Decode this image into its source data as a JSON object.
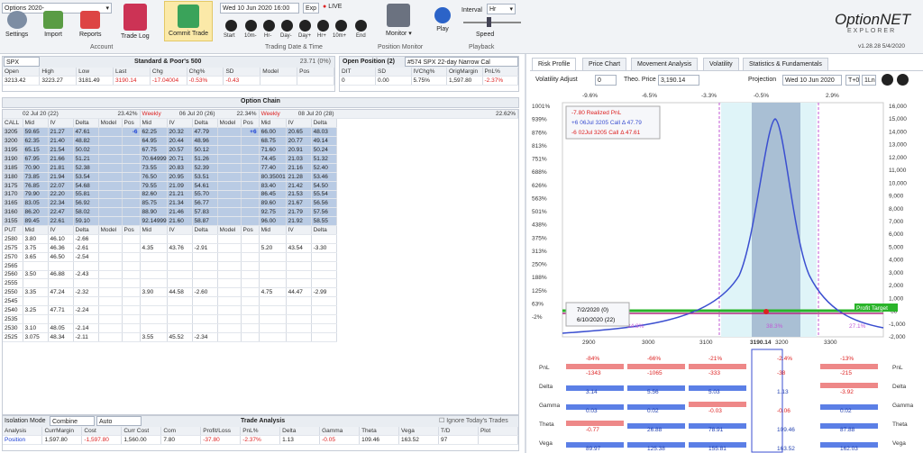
{
  "toolbar": {
    "portfolio": "Options 2020-",
    "buttons": {
      "settings": "Settings",
      "import": "Import",
      "reports": "Reports",
      "trade_log": "Trade Log",
      "commit": "Commit Trade",
      "monitor": "Monitor",
      "play": "Play"
    },
    "groups": {
      "account": "Account",
      "trading": "Trading Date & Time",
      "position_monitor": "Position Monitor",
      "playback": "Playback"
    },
    "datetime": "Wed 10 Jun 2020 16:00",
    "exp_label": "Exp",
    "live_label": "LIVE",
    "nav": [
      "Start",
      "10m-",
      "Hr-",
      "Day-",
      "Day+",
      "Hr+",
      "10m+",
      "End"
    ],
    "interval_label": "Interval",
    "interval_value": "Hr",
    "speed_label": "Speed",
    "brand1": "OptionNET",
    "brand2": "EXPLORER",
    "version": "v1.28.28  5/4/2020"
  },
  "underlying": {
    "symbol": "SPX",
    "name": "Standard & Poor's 500",
    "iv": "23.71 (0%)",
    "cols": [
      "Open",
      "High",
      "Low",
      "Last",
      "Chg",
      "Chg%",
      "SD",
      "Model",
      "Pos"
    ],
    "vals": [
      "3213.42",
      "3223.27",
      "3181.49",
      "3190.14",
      "-17.04004",
      "-0.53%",
      "-0.43",
      "",
      ""
    ]
  },
  "position": {
    "title": "Open Position (2)",
    "name": "#574 SPX 22-day Narrow Cal",
    "cols": [
      "DIT",
      "SD",
      "IVChg%",
      "OrigMargin",
      "PnL%"
    ],
    "vals": [
      "0",
      "0.00",
      "5.75%",
      "1,597.80",
      "-2.37%"
    ]
  },
  "chain": {
    "title": "Option Chain",
    "expiries": [
      {
        "label": "02 Jul 20 (22)",
        "iv": "23.42%",
        "weekly": ""
      },
      {
        "label": "06 Jul 20 (26)",
        "iv": "22.34%",
        "weekly": "Weekly"
      },
      {
        "label": "08 Jul 20 (28)",
        "iv": "22.62%",
        "weekly": "Weekly"
      }
    ],
    "call_label": "CALL",
    "put_label": "PUT",
    "cols": [
      "Mid",
      "IV",
      "Delta",
      "Model",
      "Pos"
    ],
    "calls": [
      [
        "3205",
        "59.65",
        "21.27",
        "47.61",
        "",
        "-6",
        "62.25",
        "20.32",
        "47.79",
        "",
        "+6",
        "66.00",
        "20.65",
        "48.03"
      ],
      [
        "3200",
        "62.35",
        "21.40",
        "48.82",
        "",
        "",
        "64.95",
        "20.44",
        "48.96",
        "",
        "",
        "68.75",
        "20.77",
        "49.14"
      ],
      [
        "3195",
        "65.15",
        "21.54",
        "50.02",
        "",
        "",
        "67.75",
        "20.57",
        "50.12",
        "",
        "",
        "71.60",
        "20.91",
        "50.24"
      ],
      [
        "3190",
        "67.95",
        "21.66",
        "51.21",
        "",
        "",
        "70.64999",
        "20.71",
        "51.26",
        "",
        "",
        "74.45",
        "21.03",
        "51.32"
      ],
      [
        "3185",
        "70.90",
        "21.81",
        "52.38",
        "",
        "",
        "73.55",
        "20.83",
        "52.39",
        "",
        "",
        "77.40",
        "21.16",
        "52.40"
      ],
      [
        "3180",
        "73.85",
        "21.94",
        "53.54",
        "",
        "",
        "76.50",
        "20.95",
        "53.51",
        "",
        "",
        "80.35001",
        "21.28",
        "53.46"
      ],
      [
        "3175",
        "76.85",
        "22.07",
        "54.68",
        "",
        "",
        "79.55",
        "21.09",
        "54.61",
        "",
        "",
        "83.40",
        "21.42",
        "54.50"
      ],
      [
        "3170",
        "79.90",
        "22.20",
        "55.81",
        "",
        "",
        "82.60",
        "21.21",
        "55.70",
        "",
        "",
        "86.45",
        "21.53",
        "55.54"
      ],
      [
        "3165",
        "83.05",
        "22.34",
        "56.92",
        "",
        "",
        "85.75",
        "21.34",
        "56.77",
        "",
        "",
        "89.60",
        "21.67",
        "56.56"
      ],
      [
        "3160",
        "86.20",
        "22.47",
        "58.02",
        "",
        "",
        "88.90",
        "21.46",
        "57.83",
        "",
        "",
        "92.75",
        "21.79",
        "57.56"
      ],
      [
        "3155",
        "89.45",
        "22.61",
        "59.10",
        "",
        "",
        "92.14999",
        "21.60",
        "58.87",
        "",
        "",
        "96.00",
        "21.92",
        "58.55"
      ]
    ],
    "puts": [
      [
        "2580",
        "3.80",
        "46.10",
        "-2.66",
        "",
        "",
        "",
        "",
        "",
        "",
        "",
        "",
        "",
        ""
      ],
      [
        "2575",
        "3.75",
        "46.36",
        "-2.61",
        "",
        "",
        "4.35",
        "43.76",
        "-2.91",
        "",
        "",
        "5.20",
        "43.54",
        "-3.30"
      ],
      [
        "2570",
        "3.65",
        "46.50",
        "-2.54",
        "",
        "",
        "",
        "",
        "",
        "",
        "",
        "",
        "",
        ""
      ],
      [
        "2565",
        "",
        "",
        "",
        "",
        "",
        "",
        "",
        "",
        "",
        "",
        "",
        "",
        ""
      ],
      [
        "2560",
        "3.50",
        "46.88",
        "-2.43",
        "",
        "",
        "",
        "",
        "",
        "",
        "",
        "",
        "",
        ""
      ],
      [
        "2555",
        "",
        "",
        "",
        "",
        "",
        "",
        "",
        "",
        "",
        "",
        "",
        "",
        ""
      ],
      [
        "2550",
        "3.35",
        "47.24",
        "-2.32",
        "",
        "",
        "3.90",
        "44.58",
        "-2.60",
        "",
        "",
        "4.75",
        "44.47",
        "-2.99"
      ],
      [
        "2545",
        "",
        "",
        "",
        "",
        "",
        "",
        "",
        "",
        "",
        "",
        "",
        "",
        ""
      ],
      [
        "2540",
        "3.25",
        "47.71",
        "-2.24",
        "",
        "",
        "",
        "",
        "",
        "",
        "",
        "",
        "",
        ""
      ],
      [
        "2535",
        "",
        "",
        "",
        "",
        "",
        "",
        "",
        "",
        "",
        "",
        "",
        "",
        ""
      ],
      [
        "2530",
        "3.10",
        "48.05",
        "-2.14",
        "",
        "",
        "",
        "",
        "",
        "",
        "",
        "",
        "",
        ""
      ],
      [
        "2525",
        "3.075",
        "48.34",
        "-2.11",
        "",
        "",
        "3.55",
        "45.52",
        "-2.34",
        "",
        "",
        "",
        "",
        ""
      ]
    ]
  },
  "analysis": {
    "iso_label": "Isolation Mode",
    "iso_value": "Combine",
    "auto_value": "Auto",
    "title": "Trade Analysis",
    "ignore_label": "Ignore Today's Trades",
    "cols": [
      "Analysis",
      "CurrMargin",
      "Cost",
      "Curr Cost",
      "Com",
      "Profit/Loss",
      "PnL%",
      "Delta",
      "Gamma",
      "Theta",
      "Vega",
      "T/D",
      "Plot"
    ],
    "row": [
      "Position",
      "1,597.80",
      "-1,597.80",
      "1,560.00",
      "7.80",
      "-37.80",
      "-2.37%",
      "1.13",
      "-0.05",
      "109.46",
      "163.52",
      "97",
      ""
    ]
  },
  "right": {
    "tabs": [
      "Risk Profile",
      "Price Chart",
      "Movement Analysis",
      "Volatility",
      "Statistics & Fundamentals"
    ],
    "vol_adj_label": "Volatility Adjust",
    "vol_adj_value": "0",
    "theo_label": "Theo. Price",
    "theo_value": "3,190.14",
    "proj_label": "Projection",
    "proj_value": "Wed 10 Jun 2020",
    "tplus": "T+0",
    "onelin": "1Ln",
    "top_pcts": [
      "-9.6%",
      "-6.5%",
      "-3.3%",
      "-0.5%",
      "2.9%"
    ],
    "y_left": [
      "1001%",
      "939%",
      "876%",
      "813%",
      "751%",
      "688%",
      "626%",
      "563%",
      "501%",
      "438%",
      "375%",
      "313%",
      "250%",
      "188%",
      "125%",
      "63%",
      "-2%"
    ],
    "y_right": [
      "16,000",
      "15,000",
      "14,000",
      "13,000",
      "12,000",
      "11,000",
      "10,000",
      "9,000",
      "8,000",
      "7,000",
      "6,000",
      "5,000",
      "4,000",
      "3,000",
      "2,000",
      "1,000",
      "-38",
      "-1,000",
      "-2,000"
    ],
    "x_ticks": [
      "2900",
      "3000",
      "3100",
      "3190.14",
      "3200",
      "3300"
    ],
    "legend": [
      "-7.80 Realized PnL",
      "+6 06Jul 3205 Call Δ  47.79",
      "-6 02Jul 3205 Call Δ  47.61"
    ],
    "legend2": [
      "7/2/2020 (0)",
      "6/10/2020 (22)"
    ],
    "pct_bottom": [
      "34.8%",
      "38.3%",
      "27.1%"
    ],
    "profit_target": "Profit Target",
    "greeks": {
      "labels": [
        "PnL",
        "Delta",
        "Gamma",
        "Theta",
        "Vega"
      ],
      "pnl_top": [
        "-84%",
        "-66%",
        "-21%",
        "-2.4%",
        "-13%"
      ],
      "pnl_vals": [
        "-1343",
        "-1065",
        "-333",
        "-38",
        "-215"
      ],
      "delta": [
        "3.14",
        "5.56",
        "5.03",
        "1.13",
        "-3.92"
      ],
      "gamma": [
        "0.03",
        "0.02",
        "-0.03",
        "-0.06",
        "0.02"
      ],
      "theta": [
        "-0.77",
        "26.88",
        "78.91",
        "109.46",
        "87.88"
      ],
      "vega": [
        "89.97",
        "125.38",
        "155.81",
        "163.52",
        "162.03"
      ]
    },
    "colors": {
      "accent": "#1a3fd6",
      "neg": "#d22222",
      "profit": "#2ab42a"
    }
  }
}
